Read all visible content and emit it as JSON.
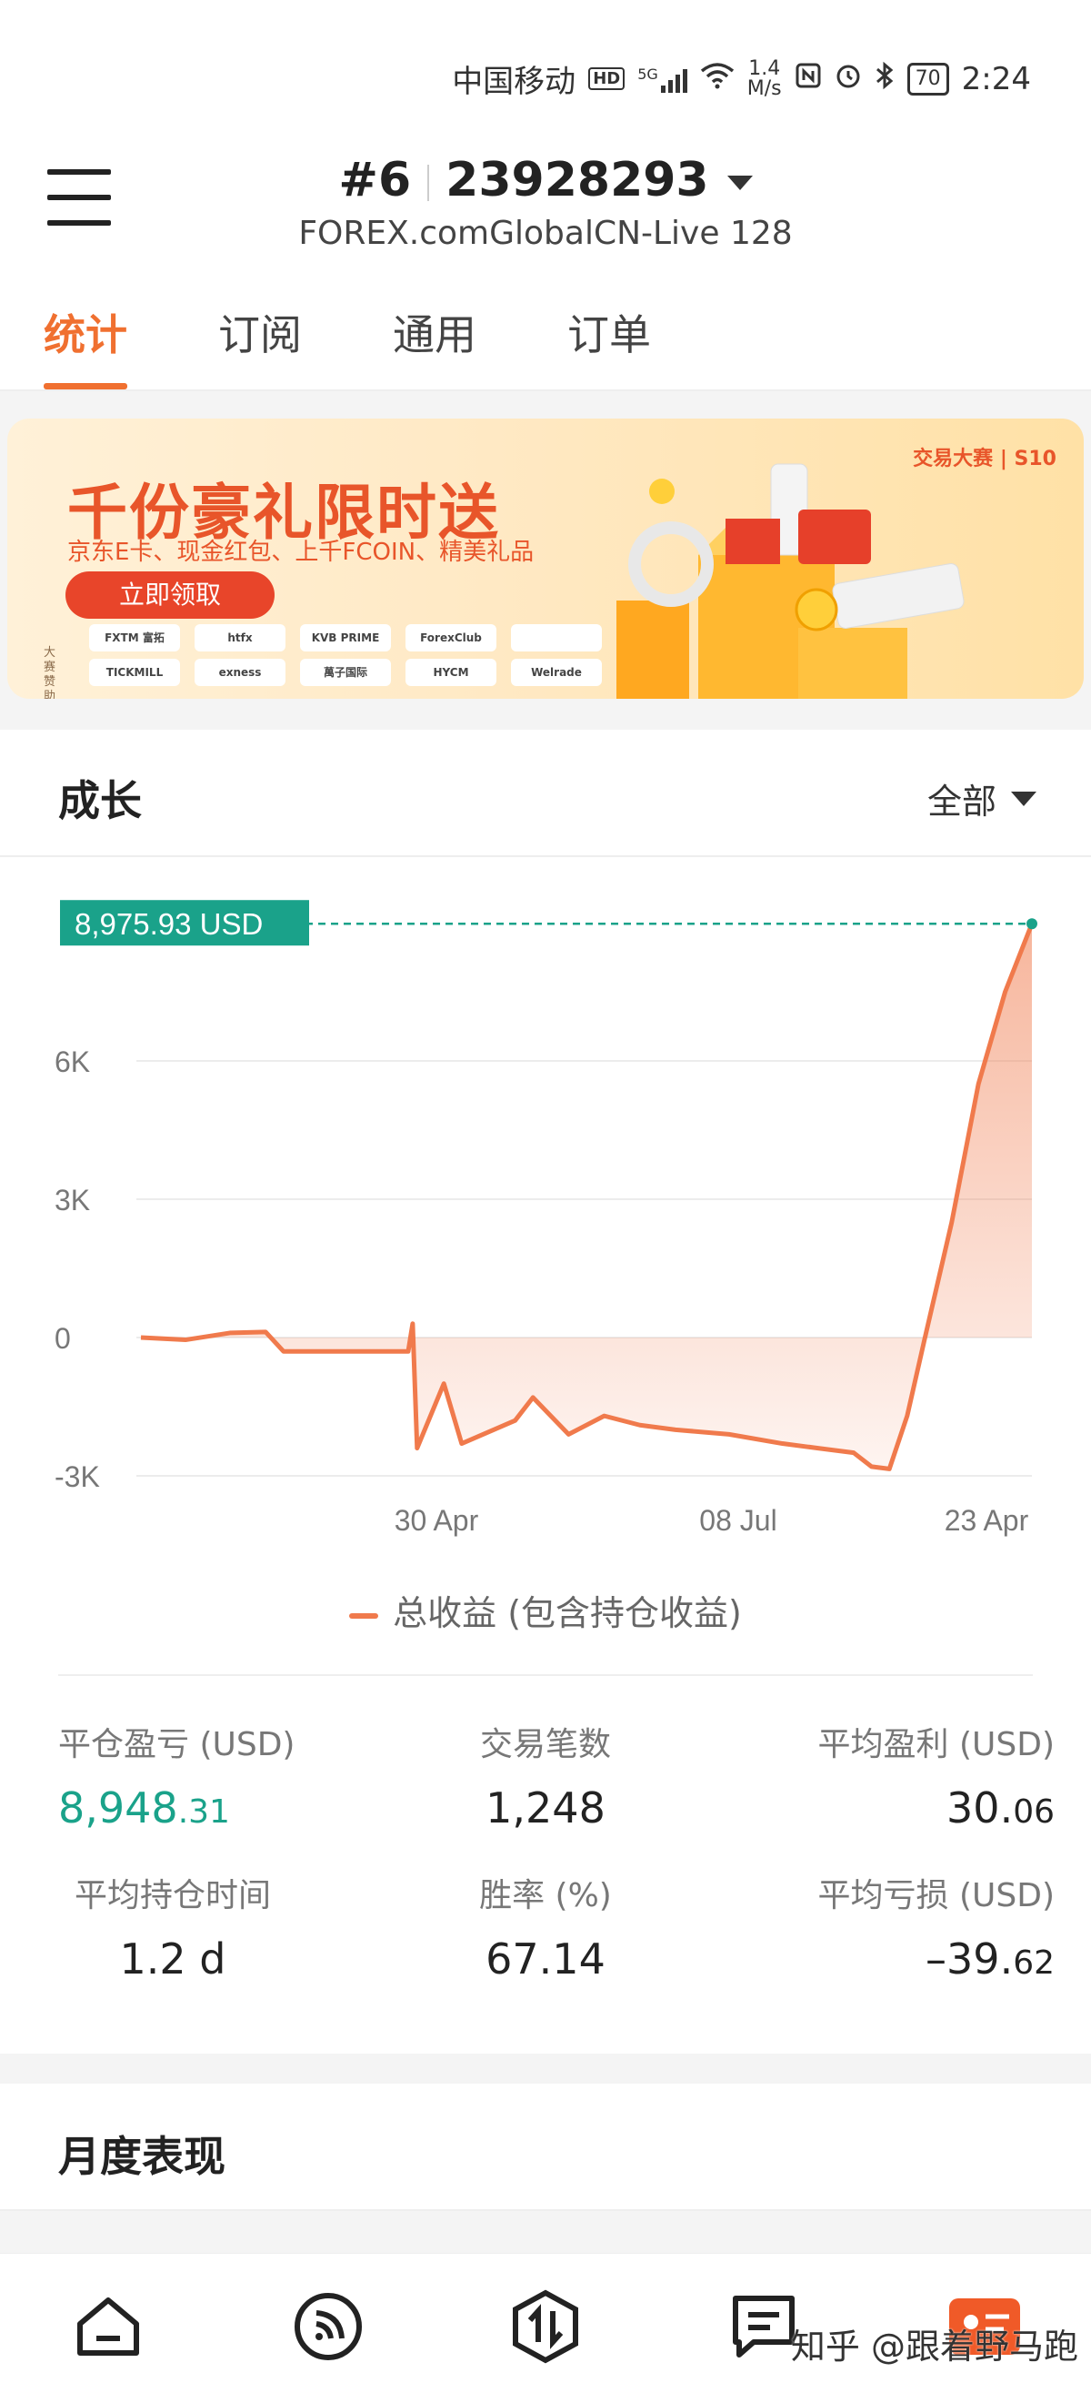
{
  "status_bar": {
    "carrier": "中国移动",
    "hd": "HD",
    "network": "5G",
    "speed_value": "1.4",
    "speed_unit": "M/s",
    "battery": "70",
    "time": "2:24"
  },
  "header": {
    "rank": "#6",
    "account_number": "23928293",
    "server": "FOREX.comGlobalCN-Live 128"
  },
  "tabs": [
    {
      "label": "统计",
      "active": true
    },
    {
      "label": "订阅",
      "active": false
    },
    {
      "label": "通用",
      "active": false
    },
    {
      "label": "订单",
      "active": false
    }
  ],
  "banner": {
    "title": "千份豪礼限时送",
    "subtitle": "京东E卡、现金红包、上千FCOIN、精美礼品",
    "button": "立即领取",
    "brand": "交易大赛 | S10",
    "sponsor_label": "大赛赞助",
    "sponsors": [
      "FXTM 富拓",
      "htfx",
      "KVB PRIME",
      "ForexClub",
      "",
      "TICKMILL",
      "exness",
      "萬子国际",
      "HYCM",
      "Welrade"
    ]
  },
  "growth": {
    "title": "成长",
    "range": "全部"
  },
  "chart_data": {
    "type": "area",
    "current_value_label": "8,975.93 USD",
    "y_ticks": [
      "6K",
      "3K",
      "0",
      "-3K"
    ],
    "x_ticks": [
      "30 Apr",
      "08 Jul",
      "23 Apr"
    ],
    "ylim": [
      -3000,
      9000
    ],
    "series": [
      {
        "name": "总收益 (包含持仓收益)",
        "values": [
          0,
          -50,
          100,
          120,
          -300,
          -300,
          -300,
          300,
          -2400,
          -1000,
          -2300,
          -1800,
          -1300,
          -2100,
          -1700,
          -1900,
          -2000,
          -2100,
          -2300,
          -2400,
          -2500,
          -2800,
          -2850,
          -1700,
          0,
          2500,
          5500,
          7500,
          8975.93
        ]
      }
    ],
    "color": "#f07a4c",
    "marker_color": "#1aa28a"
  },
  "legend": {
    "label": "总收益 (包含持仓收益)"
  },
  "stats": [
    {
      "label": "平仓盈亏 (USD)",
      "int": "8,948",
      "dec": ".31",
      "green": true
    },
    {
      "label": "交易笔数",
      "int": "1,248",
      "dec": "",
      "green": false
    },
    {
      "label": "平均盈利 (USD)",
      "int": "30.",
      "dec": "06",
      "green": false
    },
    {
      "label": "平均持仓时间",
      "int": "1.2 d",
      "dec": "",
      "green": false
    },
    {
      "label": "胜率 (%)",
      "int": "67.14",
      "dec": "",
      "green": false
    },
    {
      "label": "平均亏损 (USD)",
      "int": "–39.",
      "dec": "62",
      "green": false
    }
  ],
  "monthly": {
    "title": "月度表现"
  },
  "bottom_nav": [
    {
      "icon": "home-icon"
    },
    {
      "icon": "signal-feed-icon"
    },
    {
      "icon": "trade-icon"
    },
    {
      "icon": "message-icon"
    },
    {
      "icon": "profile-icon"
    }
  ],
  "watermark": "知乎 @跟着野马跑"
}
